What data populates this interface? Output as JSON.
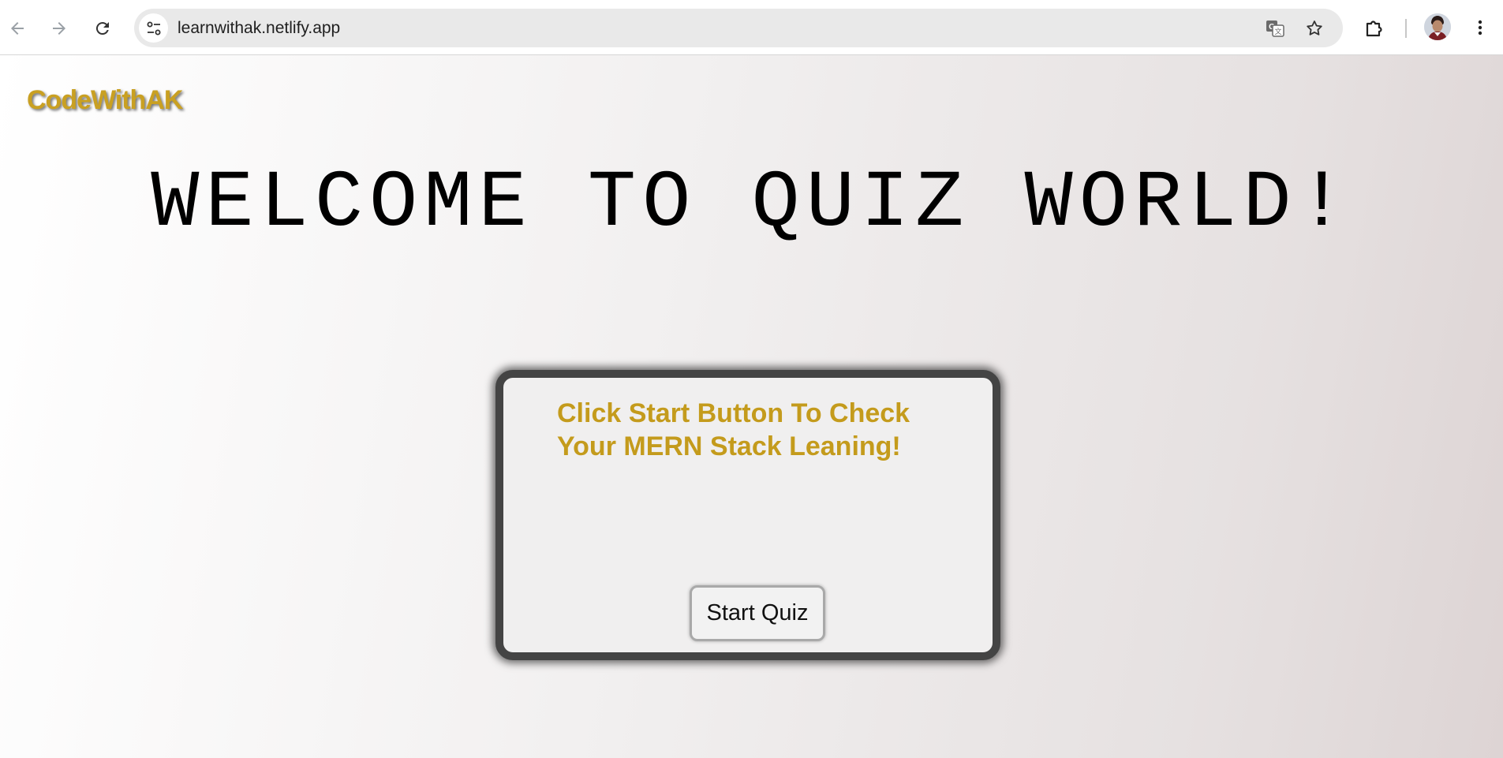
{
  "browser": {
    "url": "learnwithak.netlify.app",
    "icons": {
      "back": "arrow-left-icon",
      "forward": "arrow-right-icon",
      "reload": "reload-icon",
      "site_info": "tune-icon",
      "translate": "translate-icon",
      "bookmark": "star-icon",
      "extensions": "puzzle-icon",
      "profile": "avatar",
      "menu": "more-vert-icon"
    }
  },
  "page": {
    "brand": "CodeWithAK",
    "headline": "WELCOME TO QUIZ WORLD!",
    "quiz_card": {
      "prompt": "Click Start Button To Check Your MERN Stack Leaning!",
      "start_button": "Start Quiz"
    }
  },
  "colors": {
    "brand": "#c9a022",
    "prompt": "#c49b1c",
    "card_border": "#444444"
  }
}
